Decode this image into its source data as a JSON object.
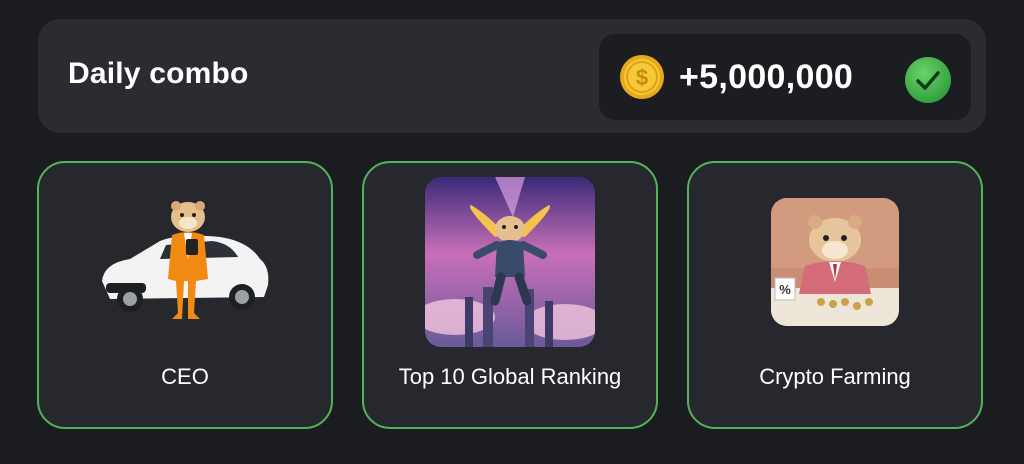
{
  "daily_combo": {
    "title": "Daily combo",
    "reward": "+5,000,000",
    "coin_icon": "coin-icon",
    "status_icon": "check-icon"
  },
  "cards": [
    {
      "label": "CEO",
      "image": "hamster-ceo-with-sports-car"
    },
    {
      "label": "Top 10 Global Ranking",
      "image": "hamster-astronaut-flying-over-city"
    },
    {
      "label": "Crypto Farming",
      "image": "hamster-businessman-at-desk-with-coins"
    }
  ],
  "colors": {
    "background": "#1b1c20",
    "panel": "#2a2c31",
    "card": "#26282d",
    "accent_green": "#55b25c",
    "coin_gold": "#f2c230"
  }
}
